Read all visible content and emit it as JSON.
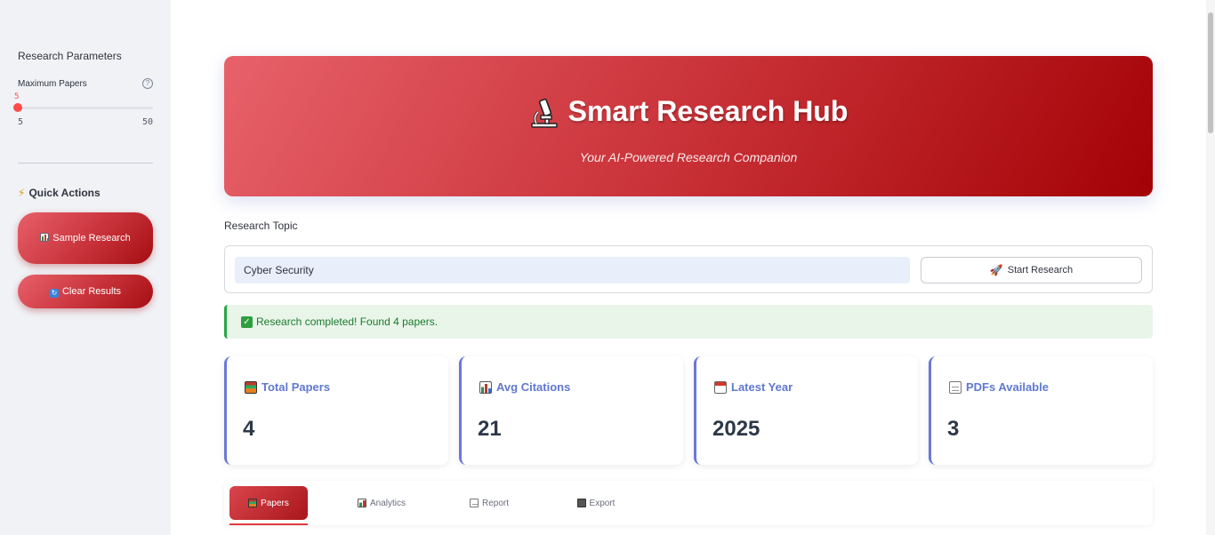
{
  "sidebar": {
    "parameters_title": "Research Parameters",
    "slider": {
      "label": "Maximum Papers",
      "value": "5",
      "min": "5",
      "max": "50",
      "help_icon": "help-circle-icon"
    },
    "quick_actions": {
      "title": "Quick Actions",
      "icon": "lightning-icon",
      "buttons": [
        {
          "label": "Sample Research",
          "icon": "bar-chart-icon"
        },
        {
          "label": "Clear Results",
          "icon": "refresh-icon"
        }
      ]
    }
  },
  "hero": {
    "title": "Smart Research Hub",
    "subtitle": "Your AI-Powered Research Companion",
    "icon": "microscope-icon",
    "gradient": [
      "#e8616a",
      "#a30205"
    ]
  },
  "form": {
    "topic_label": "Research Topic",
    "topic_value": "Cyber Security",
    "start_button": "Start Research",
    "start_icon": "rocket-icon"
  },
  "status": {
    "message": "Research completed! Found 4 papers.",
    "color": "#1a7a2e"
  },
  "metrics": [
    {
      "title": "Total Papers",
      "value": "4",
      "icon": "books-icon"
    },
    {
      "title": "Avg Citations",
      "value": "21",
      "icon": "bar-chart-icon"
    },
    {
      "title": "Latest Year",
      "value": "2025",
      "icon": "calendar-icon"
    },
    {
      "title": "PDFs Available",
      "value": "3",
      "icon": "page-icon"
    }
  ],
  "tabs": [
    {
      "label": "Papers",
      "icon": "books-icon",
      "active": true
    },
    {
      "label": "Analytics",
      "icon": "bar-chart-icon",
      "active": false
    },
    {
      "label": "Report",
      "icon": "memo-icon",
      "active": false
    },
    {
      "label": "Export",
      "icon": "floppy-disk-icon",
      "active": false
    }
  ],
  "colors": {
    "accent": "#ff4b4b",
    "metric_title": "#6078d0",
    "metric_border": "#6a78d8"
  }
}
